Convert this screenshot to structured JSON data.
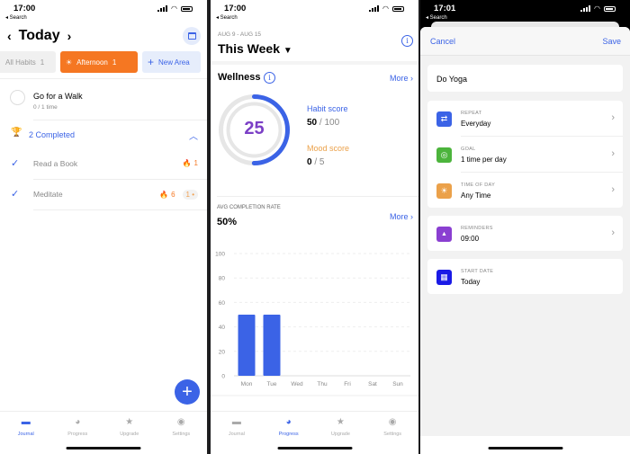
{
  "colors": {
    "accent": "#3b63e6",
    "orange": "#f57722",
    "purple": "#7b3fc6",
    "mood": "#eba14a"
  },
  "screens": [
    {
      "status": {
        "time": "17:00",
        "back": "◂ Search"
      }
    },
    {
      "status": {
        "time": "17:00",
        "back": "◂ Search"
      }
    },
    {
      "status": {
        "time": "17:01",
        "back": "◂ Search"
      }
    }
  ],
  "journal": {
    "title": "Today",
    "prev_icon": "chevron-left-icon",
    "next_icon": "chevron-right-icon",
    "calendar_icon": "calendar-icon",
    "areas": [
      {
        "label": "All Habits",
        "count": "1"
      },
      {
        "label": "Afternoon",
        "count": "1",
        "icon": "sun-icon"
      },
      {
        "label": "New Area",
        "icon": "plus-icon"
      }
    ],
    "pending": [
      {
        "name": "Go for a Walk",
        "progress": "0 / 1 time"
      }
    ],
    "completed_label": "2 Completed",
    "completed": [
      {
        "name": "Read a Book",
        "streak": "1"
      },
      {
        "name": "Meditate",
        "streak": "6",
        "pill": "1"
      }
    ],
    "fab": "+"
  },
  "tabs": [
    {
      "label": "Journal",
      "icon": "journal-icon"
    },
    {
      "label": "Progress",
      "icon": "pie-chart-icon"
    },
    {
      "label": "Upgrade",
      "icon": "star-icon"
    },
    {
      "label": "Settings",
      "icon": "person-icon"
    }
  ],
  "progress": {
    "range": "AUG 9 - AUG 15",
    "title": "This Week",
    "wellness": {
      "title": "Wellness",
      "more": "More",
      "score": "25",
      "score_fraction": 0.5,
      "habit_label": "Habit score",
      "habit_value": "50",
      "habit_max": "/ 100",
      "mood_label": "Mood score",
      "mood_value": "0",
      "mood_max": "/ 5"
    },
    "avg_label": "AVG COMPLETION RATE",
    "avg_value": "50%",
    "avg_more": "More"
  },
  "chart_data": {
    "type": "bar",
    "title": "",
    "xlabel": "",
    "ylabel": "",
    "categories": [
      "Mon",
      "Tue",
      "Wed",
      "Thu",
      "Fri",
      "Sat",
      "Sun"
    ],
    "values": [
      50,
      50,
      0,
      0,
      0,
      0,
      0
    ],
    "ylim": [
      0,
      100
    ],
    "yticks": [
      0,
      20,
      40,
      60,
      80,
      100
    ],
    "grid": true,
    "color": "#3b63e6"
  },
  "edit": {
    "cancel": "Cancel",
    "save": "Save",
    "name": "Do Yoga",
    "rows": [
      {
        "label": "REPEAT",
        "value": "Everyday",
        "icon": "repeat-icon",
        "color": "#3b63e6",
        "glyph": "⇄"
      },
      {
        "label": "GOAL",
        "value": "1 time per day",
        "icon": "target-icon",
        "color": "#4cb43c",
        "glyph": "◎"
      },
      {
        "label": "TIME OF DAY",
        "value": "Any Time",
        "icon": "sun-icon",
        "color": "#eba14a",
        "glyph": "☀"
      }
    ],
    "reminders": {
      "label": "REMINDERS",
      "value": "09:00",
      "icon": "bell-icon",
      "color": "#8a3fd1",
      "glyph": "🔔"
    },
    "start": {
      "label": "START DATE",
      "value": "Today",
      "icon": "calendar-icon",
      "color": "#1a1ae6",
      "glyph": "▦"
    }
  }
}
